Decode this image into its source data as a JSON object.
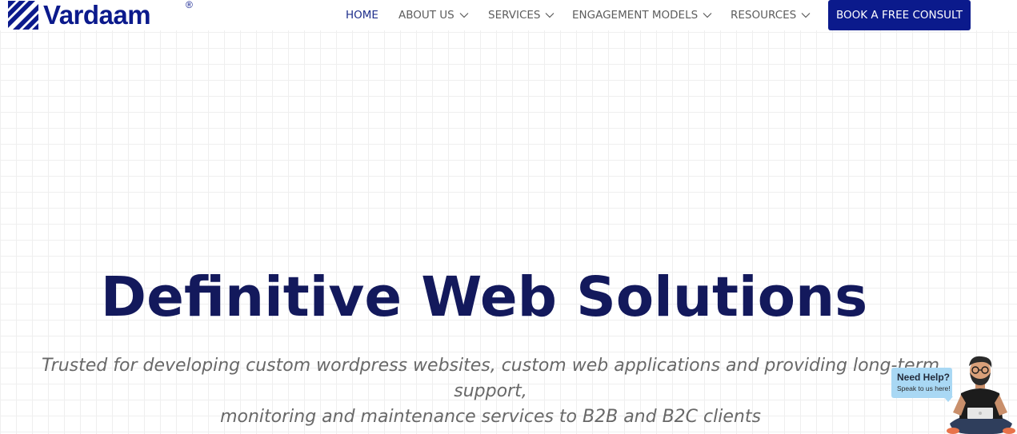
{
  "brand": {
    "name": "Vardaam",
    "registered": "®"
  },
  "nav": {
    "items": [
      {
        "label": "HOME",
        "active": true,
        "dropdown": false
      },
      {
        "label": "ABOUT US",
        "active": false,
        "dropdown": true
      },
      {
        "label": "SERVICES",
        "active": false,
        "dropdown": true
      },
      {
        "label": "ENGAGEMENT MODELS",
        "active": false,
        "dropdown": true
      },
      {
        "label": "RESOURCES",
        "active": false,
        "dropdown": true
      }
    ],
    "cta": "BOOK A FREE CONSULT"
  },
  "hero": {
    "title": "Definitive Web Solutions",
    "subtitle_line1": "Trusted for developing custom wordpress websites, custom web applications and providing long-term support,",
    "subtitle_line2": "monitoring and maintenance services to B2B and B2C clients"
  },
  "help_widget": {
    "title": "Need Help?",
    "subtitle": "Speak to us here!"
  },
  "colors": {
    "brand": "#0b1a8c",
    "title": "#13195c",
    "active_nav": "#1e2f8c",
    "nav_text": "#5d5d5d",
    "bubble": "#a9d8f4"
  },
  "icons": [
    "vardaam-logo-icon",
    "chevron-down-icon",
    "support-person-icon"
  ]
}
